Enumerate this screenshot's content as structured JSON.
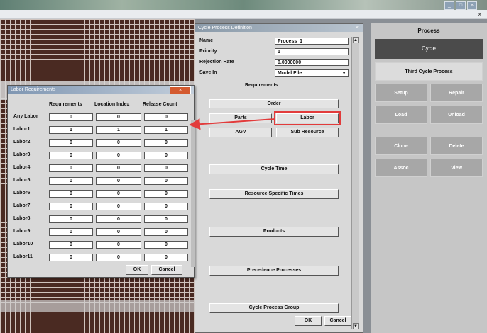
{
  "cycle_dialog": {
    "title": "Cycle Process Definition",
    "fields": [
      {
        "label": "Name",
        "value": "Process_1"
      },
      {
        "label": "Priority",
        "value": "1"
      },
      {
        "label": "Rejection Rate",
        "value": "0.0000000"
      },
      {
        "label": "Save In",
        "value": "Model File"
      }
    ],
    "requirements_heading": "Requirements",
    "buttons": {
      "order": "Order",
      "parts": "Parts",
      "labor": "Labor",
      "agv": "AGV",
      "sub_resource": "Sub Resource",
      "cycle_time": "Cycle Time",
      "resource_specific_times": "Resource Specific Times",
      "products": "Products",
      "precedence_processes": "Precedence Processes",
      "cycle_process_group": "Cycle Process Group",
      "ok": "OK",
      "cancel": "Cancel"
    },
    "highlight_color": "#e23b3b"
  },
  "labor_dialog": {
    "title": "Labor Requirements",
    "columns": [
      "Requirements",
      "Location Index",
      "Release Count"
    ],
    "rows": [
      {
        "label": "Any Labor",
        "values": [
          "0",
          "0",
          "0"
        ]
      },
      {
        "label": "Labor1",
        "values": [
          "1",
          "1",
          "1"
        ]
      },
      {
        "label": "Labor2",
        "values": [
          "0",
          "0",
          "0"
        ]
      },
      {
        "label": "Labor3",
        "values": [
          "0",
          "0",
          "0"
        ]
      },
      {
        "label": "Labor4",
        "values": [
          "0",
          "0",
          "0"
        ]
      },
      {
        "label": "Labor5",
        "values": [
          "0",
          "0",
          "0"
        ]
      },
      {
        "label": "Labor6",
        "values": [
          "0",
          "0",
          "0"
        ]
      },
      {
        "label": "Labor7",
        "values": [
          "0",
          "0",
          "0"
        ]
      },
      {
        "label": "Labor8",
        "values": [
          "0",
          "0",
          "0"
        ]
      },
      {
        "label": "Labor9",
        "values": [
          "0",
          "0",
          "0"
        ]
      },
      {
        "label": "Labor10",
        "values": [
          "0",
          "0",
          "0"
        ]
      },
      {
        "label": "Labor11",
        "values": [
          "0",
          "0",
          "0"
        ]
      }
    ],
    "buttons": {
      "ok": "OK",
      "cancel": "Cancel"
    }
  },
  "right_panel": {
    "title": "Process",
    "active": "Cycle",
    "third_cycle": "Third Cycle Process",
    "buttons": [
      "Setup",
      "Repair",
      "Load",
      "Unload",
      "Clone",
      "Delete",
      "Assoc",
      "View"
    ]
  },
  "icons": [
    "close-icon",
    "minimize-icon",
    "maximize-icon",
    "dropdown-arrow-icon",
    "scroll-up-icon",
    "scroll-down-icon"
  ]
}
